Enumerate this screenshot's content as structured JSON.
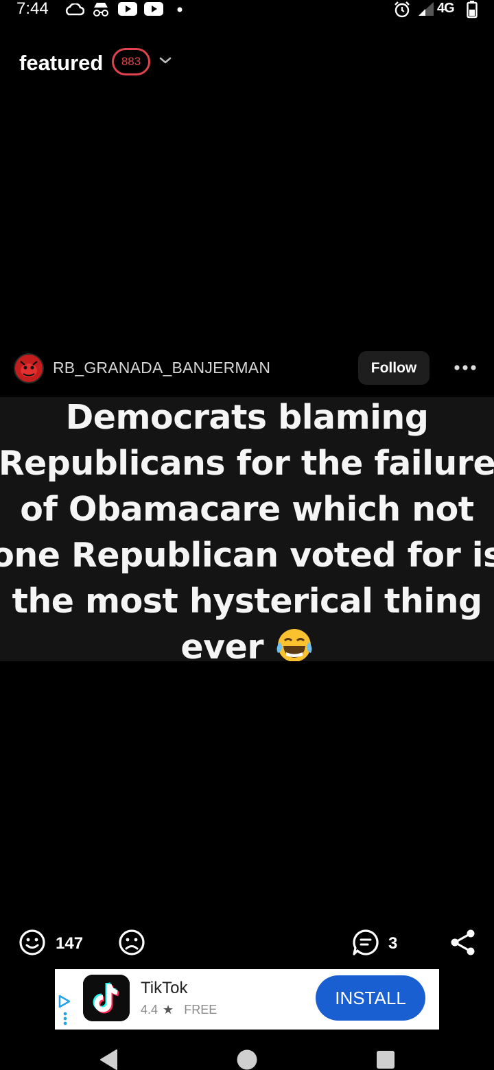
{
  "status_bar": {
    "time": "7:44",
    "network": "4G",
    "icons": [
      "cloud-icon",
      "incognito-icon",
      "youtube-icon",
      "youtube-icon",
      "dot-icon",
      "alarm-icon",
      "signal-icon",
      "battery-icon"
    ]
  },
  "header": {
    "title": "featured",
    "count": "883"
  },
  "post": {
    "username": "RB_GRANADA_BANJERMAN",
    "follow_label": "Follow",
    "text_lines": [
      "Democrats blaming",
      "Republicans for the failure",
      "of Obamacare which not",
      "one Republican voted for is",
      "the most hysterical thing",
      "ever"
    ],
    "upvotes": "147",
    "comments": "3"
  },
  "ad": {
    "app_name": "TikTok",
    "rating": "4.4",
    "price": "FREE",
    "install_label": "INSTALL"
  },
  "colors": {
    "background": "#000000",
    "badge": "#e0434b",
    "install": "#1a5fd1",
    "follow_bg": "#1e1e1e"
  }
}
